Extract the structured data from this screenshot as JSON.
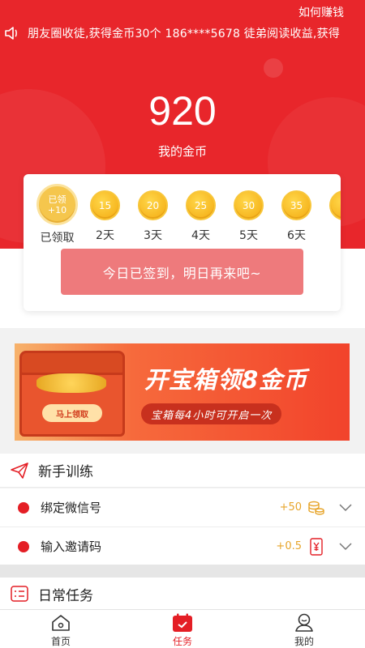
{
  "header": {
    "howto_label": "如何赚钱",
    "ticker_text": "朋友圈收徒,获得金币30个    186****5678    徒弟阅读收益,获得"
  },
  "coins": {
    "value": "920",
    "label": "我的金币"
  },
  "checkin": {
    "days": [
      {
        "top": "已领",
        "bottom": "+10",
        "label": "已领取",
        "claimed": true
      },
      {
        "top": "15",
        "label": "2天"
      },
      {
        "top": "20",
        "label": "3天"
      },
      {
        "top": "25",
        "label": "4天"
      },
      {
        "top": "30",
        "label": "5天"
      },
      {
        "top": "35",
        "label": "6天"
      },
      {
        "top": "",
        "label": ""
      }
    ],
    "button_label": "今日已签到，明日再来吧~"
  },
  "banner": {
    "title": "开宝箱领8金币",
    "subtitle": "宝箱每4小时可开启一次",
    "chest_button": "马上领取"
  },
  "newbie": {
    "title": "新手训练",
    "tasks": [
      {
        "name": "绑定微信号",
        "reward": "+50",
        "icon": "coins-icon"
      },
      {
        "name": "输入邀请码",
        "reward": "+0.5",
        "icon": "yuan-note-icon"
      }
    ]
  },
  "daily": {
    "title": "日常任务"
  },
  "tabs": [
    {
      "label": "首页",
      "icon": "home-icon"
    },
    {
      "label": "任务",
      "icon": "calendar-icon",
      "active": true
    },
    {
      "label": "我的",
      "icon": "user-icon"
    }
  ],
  "colors": {
    "primary": "#e8262b",
    "button_disabled": "#ee7a7c",
    "coin_gold": "#f5b31c",
    "reward_text": "#e7a52b"
  }
}
